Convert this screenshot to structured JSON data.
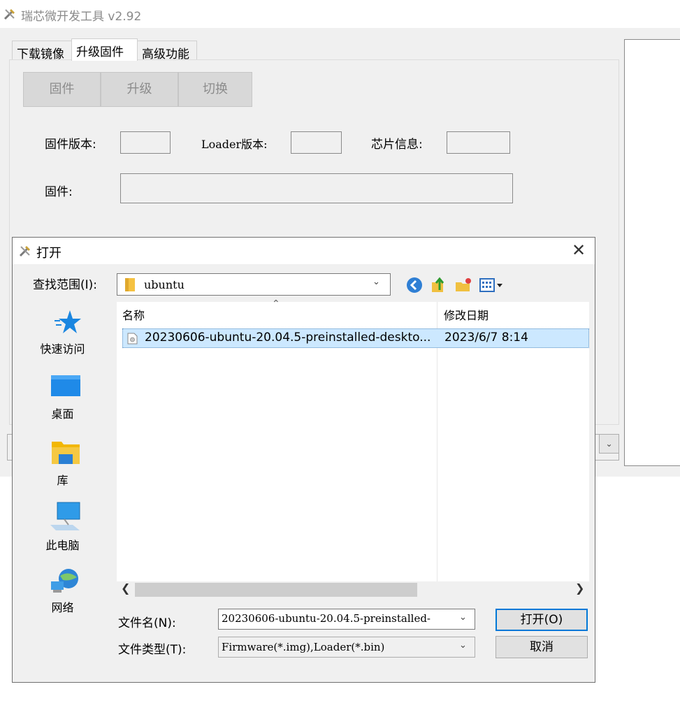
{
  "app": {
    "title": "瑞芯微开发工具 v2.92"
  },
  "tabs": [
    "下载镜像",
    "升级固件",
    "高级功能"
  ],
  "actions": {
    "firmware": "固件",
    "upgrade": "升级",
    "switch": "切换"
  },
  "info": {
    "fw_version_label": "固件版本:",
    "loader_version_label": "Loader版本:",
    "chip_info_label": "芯片信息:",
    "firmware_label": "固件:"
  },
  "dialog": {
    "title": "打开",
    "close": "✕",
    "look_in_label": "查找范围(I):",
    "look_in_value": "ubuntu",
    "places": [
      {
        "label": "快速访问",
        "icon": "star-icon"
      },
      {
        "label": "桌面",
        "icon": "desktop-icon"
      },
      {
        "label": "库",
        "icon": "library-icon"
      },
      {
        "label": "此电脑",
        "icon": "computer-icon"
      },
      {
        "label": "网络",
        "icon": "network-icon"
      }
    ],
    "columns": {
      "name": "名称",
      "date": "修改日期"
    },
    "files": [
      {
        "name": "20230606-ubuntu-20.04.5-preinstalled-deskto...",
        "date": "2023/6/7 8:14"
      }
    ],
    "file_name_label": "文件名(N):",
    "file_name_value": "20230606-ubuntu-20.04.5-preinstalled-",
    "file_type_label": "文件类型(T):",
    "file_type_value": "Firmware(*.img),Loader(*.bin)",
    "open_button": "打开(O)",
    "cancel_button": "取消"
  }
}
